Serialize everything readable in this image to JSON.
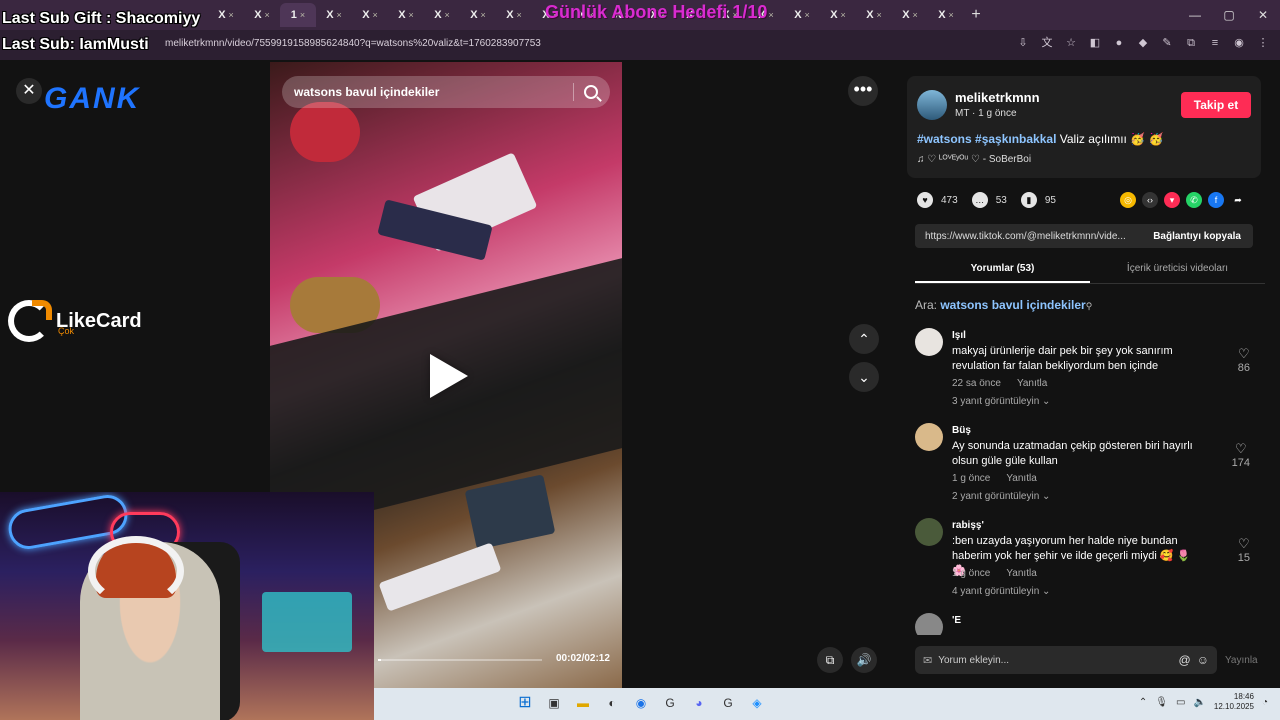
{
  "overlay": {
    "last_sub_gift": "Last Sub Gift : Shacomiyy",
    "last_sub": "Last Sub: IamMusti",
    "sub_goal": "Günlük Abone Hedefi 1/10"
  },
  "browser": {
    "url": "meliketrkmnn/video/7559919158985624840?q=watsons%20valiz&t=1760283907753",
    "tabs": [
      {
        "label": "X"
      },
      {
        "label": "X"
      },
      {
        "label": "1",
        "active": true
      },
      {
        "label": "X"
      },
      {
        "label": "X"
      },
      {
        "label": "X"
      },
      {
        "label": "X"
      },
      {
        "label": "X"
      },
      {
        "label": "X"
      },
      {
        "label": "X"
      },
      {
        "label": "X"
      },
      {
        "label": "X"
      },
      {
        "label": "X"
      },
      {
        "label": "X"
      },
      {
        "label": "X"
      },
      {
        "label": "X"
      },
      {
        "label": "X"
      },
      {
        "label": "X"
      },
      {
        "label": "X"
      },
      {
        "label": "X"
      },
      {
        "label": "X"
      }
    ],
    "new_tab": "+",
    "window_controls": [
      "—",
      "▢",
      "✕"
    ]
  },
  "left": {
    "close": "✕",
    "gank_logo": "GANK",
    "likecard_name": "LikeCard",
    "likecard_sub": "Çok"
  },
  "video": {
    "search_query": "watsons bavul içindekiler",
    "time": "00:02/02:12",
    "progress": 0.02
  },
  "controls": {
    "more": "•••",
    "up": "⌃",
    "down": "⌄",
    "pip": "⧉",
    "volume": "🔊"
  },
  "post": {
    "username": "meliketrkmnn",
    "meta": "MT · 1 g önce",
    "follow_label": "Takip et",
    "caption_tags": "#watsons #şaşkınbakkal",
    "caption_text": " Valiz açılımıı 🥳 🥳",
    "music": "♫  ♡ ᴸᴼⱽᴱʸᴼᵘ ♡ - SoBerBoi",
    "likes": "473",
    "comments_count": "53",
    "saves": "95",
    "link": "https://www.tiktok.com/@meliketrkmnn/vide...",
    "copy_link": "Bağlantıyı kopyala"
  },
  "panel_tabs": [
    {
      "label": "Yorumlar (53)",
      "active": true
    },
    {
      "label": "İçerik üreticisi videoları",
      "active": false
    }
  ],
  "search_ref": {
    "prefix": "Ara: ",
    "query": "watsons bavul içindekiler"
  },
  "comments": [
    {
      "name": "Işıl",
      "text": "makyaj ürünlerije dair pek bir şey yok sanırım revulation far falan bekliyordum ben içinde",
      "time": "22 sa önce",
      "reply": "Yanıtla",
      "replies": "3 yanıt görüntüleyin ⌄",
      "likes": "86"
    },
    {
      "name": "Büş",
      "text": "Ay sonunda uzatmadan çekip gösteren biri hayırlı olsun güle güle kullan",
      "time": "1 g önce",
      "reply": "Yanıtla",
      "replies": "2 yanıt görüntüleyin ⌄",
      "likes": "174"
    },
    {
      "name": "rabişş'",
      "text": ":ben uzayda yaşıyorum her halde niye bundan haberim yok her şehir ve ilde geçerli miydi 🥰 🌷 🌸",
      "time": "1 g önce",
      "reply": "Yanıtla",
      "replies": "4 yanıt görüntüleyin ⌄",
      "likes": "15"
    },
    {
      "name": "'E",
      "text": "",
      "time": "",
      "reply": "",
      "replies": "",
      "likes": ""
    }
  ],
  "add_comment": {
    "placeholder": "Yorum ekleyin...",
    "post": "Yayınla"
  },
  "taskbar": {
    "time": "18:46",
    "date": "12.10.2025"
  }
}
